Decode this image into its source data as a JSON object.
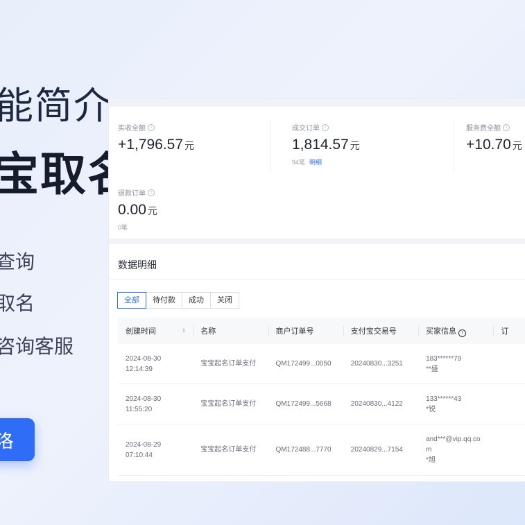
{
  "hero": {
    "line1": "能简介",
    "line2": "宝取名",
    "features": [
      "查询",
      "取名",
      "咨询客服"
    ],
    "cta": "洛"
  },
  "stats": {
    "received": {
      "label": "实收全额",
      "value": "+1,796.57",
      "unit": "元"
    },
    "orders": {
      "label": "成交订单",
      "value": "1,814.57",
      "unit": "元",
      "count": "94笔",
      "detail": "明细"
    },
    "fee": {
      "label": "服务费全额",
      "value": "+10.70",
      "unit": "元"
    },
    "refund": {
      "label": "退款订单",
      "value": "0.00",
      "unit": "元",
      "count": "0笔"
    }
  },
  "details": {
    "title": "数据明细",
    "tabs": [
      "全部",
      "待付款",
      "成功",
      "关闭"
    ],
    "columns": [
      "创建时间",
      "名称",
      "商户订单号",
      "支付宝交易号",
      "买家信息",
      "订"
    ],
    "rows": [
      {
        "date": "2024-08-30",
        "time": "12:14:39",
        "name": "宝宝起名订单支付",
        "order": "QM172499...0050",
        "trade": "20240830...3251",
        "buyer1": "183******79",
        "buyer2": "**盛",
        "buyer3": ""
      },
      {
        "date": "2024-08-30",
        "time": "11:55:20",
        "name": "宝宝起名订单支付",
        "order": "QM172499...5668",
        "trade": "20240830...4122",
        "buyer1": "133******43",
        "buyer2": "*锐",
        "buyer3": ""
      },
      {
        "date": "2024-08-29",
        "time": "07:10:44",
        "name": "宝宝起名订单支付",
        "order": "QM172488...7770",
        "trade": "20240829...7154",
        "buyer1": "and***@vip.qq.co",
        "buyer2": "m",
        "buyer3": "*旭"
      }
    ]
  },
  "colors": {
    "accent": "#2f6df6",
    "background": "#e8effb"
  }
}
